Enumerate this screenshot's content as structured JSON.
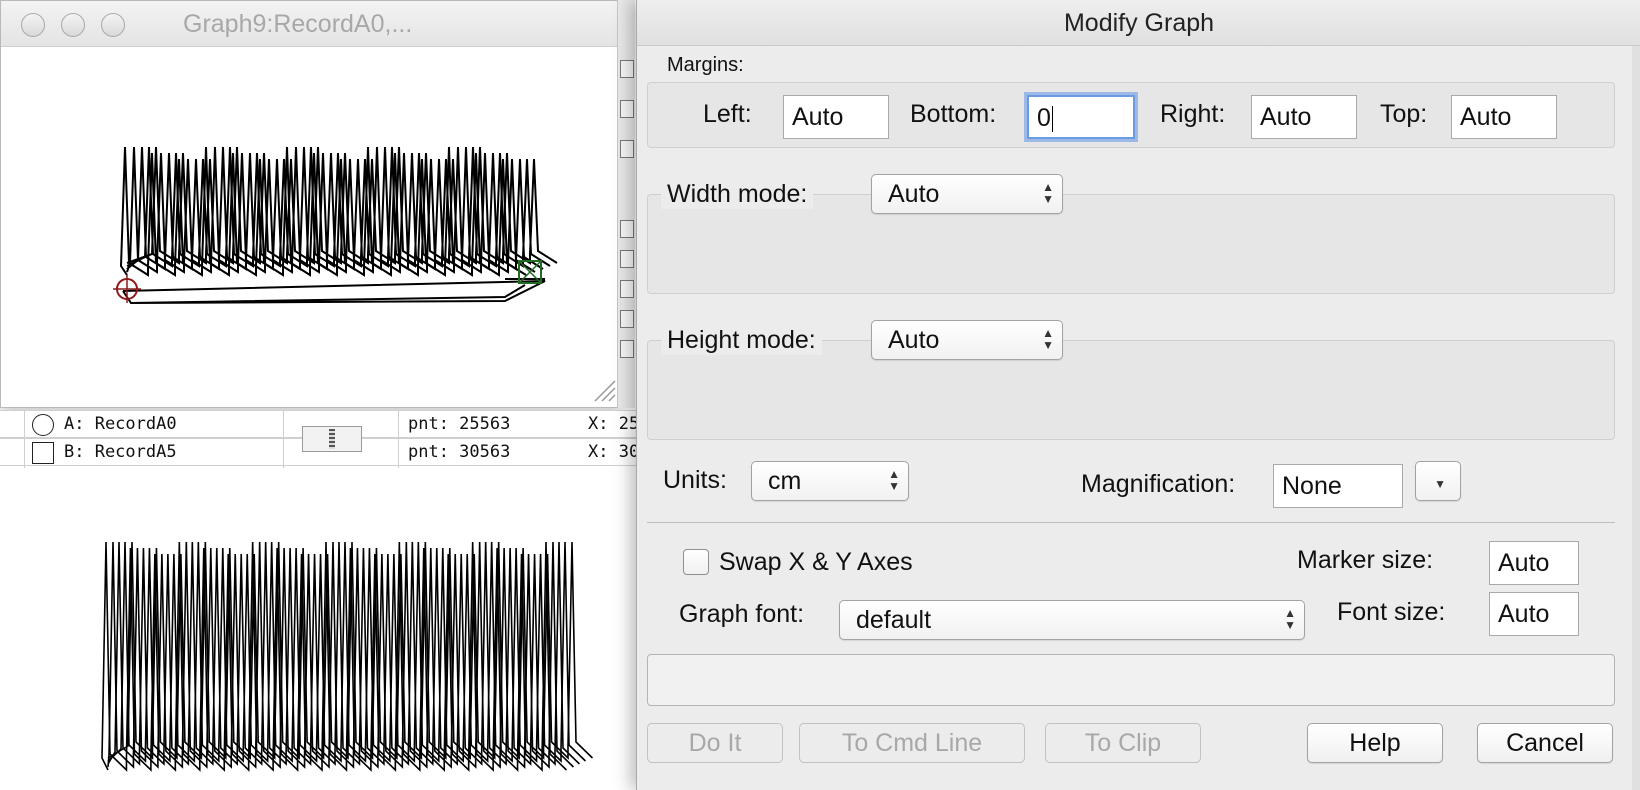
{
  "graph_window": {
    "title": "Graph9:RecordA0,..."
  },
  "cursor_info": {
    "rows": [
      {
        "label": "A: RecordA0",
        "point": "pnt: 25563",
        "x": "X: 25"
      },
      {
        "label": "B: RecordA5",
        "point": "pnt: 30563",
        "x": "X: 30"
      }
    ]
  },
  "dialog": {
    "title": "Modify Graph",
    "margins": {
      "section_label": "Margins:",
      "left_label": "Left:",
      "left_value": "Auto",
      "bottom_label": "Bottom:",
      "bottom_value": "0",
      "right_label": "Right:",
      "right_value": "Auto",
      "top_label": "Top:",
      "top_value": "Auto"
    },
    "width_mode": {
      "label": "Width mode:",
      "value": "Auto"
    },
    "height_mode": {
      "label": "Height mode:",
      "value": "Auto"
    },
    "units": {
      "label": "Units:",
      "value": "cm"
    },
    "magnification": {
      "label": "Magnification:",
      "value": "None"
    },
    "swap_axes": {
      "label": "Swap X & Y Axes",
      "checked": false
    },
    "marker_size": {
      "label": "Marker size:",
      "value": "Auto"
    },
    "graph_font": {
      "label": "Graph font:",
      "value": "default"
    },
    "font_size": {
      "label": "Font size:",
      "value": "Auto"
    },
    "command_line": "",
    "buttons": {
      "do_it": "Do It",
      "to_cmd_line": "To Cmd Line",
      "to_clip": "To Clip",
      "help": "Help",
      "cancel": "Cancel"
    }
  }
}
